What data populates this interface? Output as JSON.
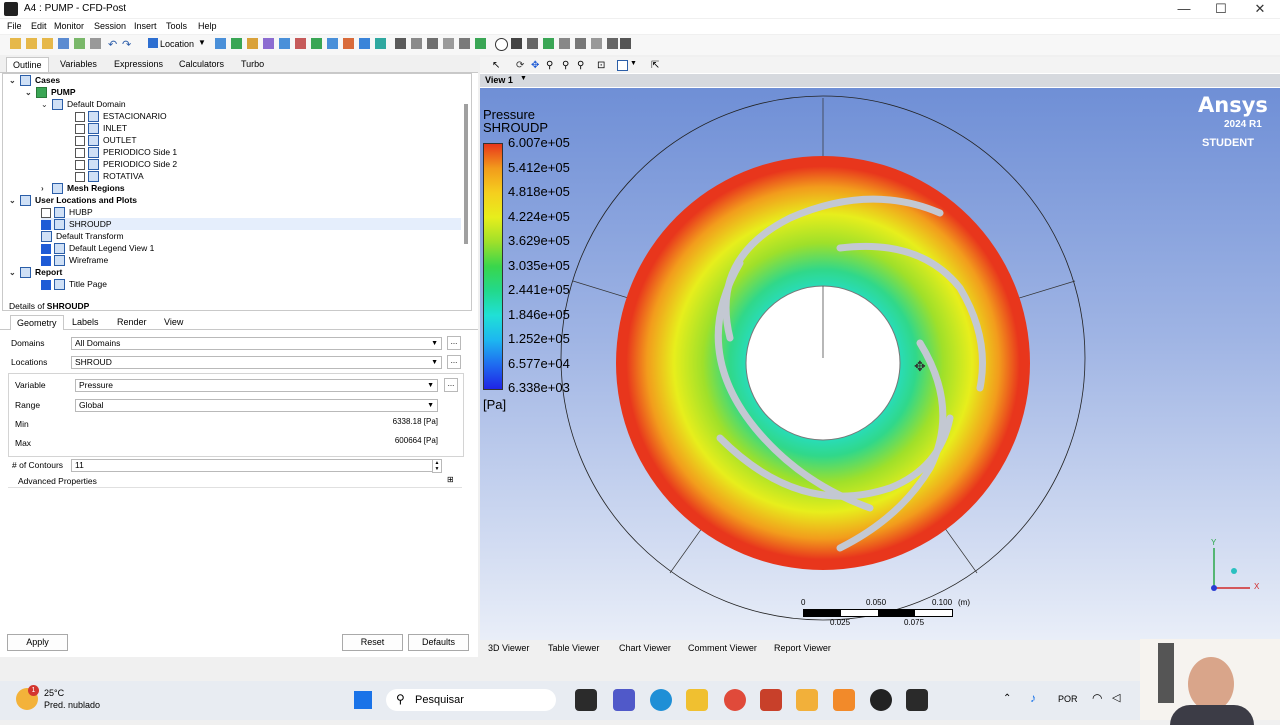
{
  "window": {
    "title": "A4 : PUMP - CFD-Post",
    "controls": [
      "—",
      "☐",
      "✕"
    ]
  },
  "menu": [
    "File",
    "Edit",
    "Monitor",
    "Session",
    "Insert",
    "Tools",
    "Help"
  ],
  "toolbar": {
    "location_label": "Location"
  },
  "left_tabs": [
    "Outline",
    "Variables",
    "Expressions",
    "Calculators",
    "Turbo"
  ],
  "tree": {
    "cases": "Cases",
    "pump": "PUMP",
    "default_domain": "Default Domain",
    "boundaries": [
      "ESTACIONARIO",
      "INLET",
      "OUTLET",
      "PERIODICO Side 1",
      "PERIODICO Side 2",
      "ROTATIVA"
    ],
    "mesh_regions": "Mesh Regions",
    "user_locations": "User Locations and Plots",
    "hubp": "HUBP",
    "shroudp": "SHROUDP",
    "default_transform": "Default Transform",
    "default_legend": "Default Legend View 1",
    "wireframe": "Wireframe",
    "report": "Report",
    "title_page": "Title Page"
  },
  "details": {
    "header_prefix": "Details of ",
    "header_name": "SHROUDP",
    "tabs": [
      "Geometry",
      "Labels",
      "Render",
      "View"
    ],
    "domains_label": "Domains",
    "domains_value": "All Domains",
    "locations_label": "Locations",
    "locations_value": "SHROUD",
    "variable_label": "Variable",
    "variable_value": "Pressure",
    "range_label": "Range",
    "range_value": "Global",
    "min_label": "Min",
    "min_value": "6338.18 [Pa]",
    "max_label": "Max",
    "max_value": "600664 [Pa]",
    "contours_label": "# of Contours",
    "contours_value": "11",
    "advanced": "Advanced Properties",
    "apply": "Apply",
    "reset": "Reset",
    "defaults": "Defaults"
  },
  "viewer": {
    "view_label": "View 1",
    "legend_title": "Pressure",
    "legend_sub": "SHROUDP",
    "legend_values": [
      "6.007e+05",
      "5.412e+05",
      "4.818e+05",
      "4.224e+05",
      "3.629e+05",
      "3.035e+05",
      "2.441e+05",
      "1.846e+05",
      "1.252e+05",
      "6.577e+04",
      "6.338e+03"
    ],
    "legend_colors": [
      "#e8361c",
      "#f29c1c",
      "#f5cf1e",
      "#e7ee1c",
      "#9fe02a",
      "#39d64c",
      "#22d98c",
      "#20e0d6",
      "#1db7f0",
      "#1f6cf0",
      "#1f24e6"
    ],
    "legend_unit": "[Pa]",
    "brand": "Ansys",
    "version": "2024 R1",
    "edition": "STUDENT",
    "scale_top": [
      "0",
      "0.050",
      "0.100",
      "(m)"
    ],
    "scale_bottom": [
      "0.025",
      "0.075"
    ],
    "axis_y": "Y",
    "axis_x": "X"
  },
  "viewer_tabs": [
    "3D Viewer",
    "Table Viewer",
    "Chart Viewer",
    "Comment Viewer",
    "Report Viewer"
  ],
  "taskbar": {
    "weather_temp": "25°C",
    "weather_desc": "Pred. nublado",
    "weather_badge": "1",
    "search": "Pesquisar",
    "language": "POR"
  }
}
